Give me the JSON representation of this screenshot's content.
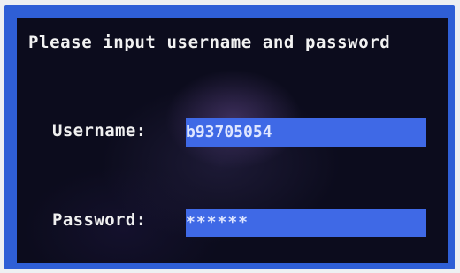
{
  "login_screen": {
    "prompt": "Please input username and password",
    "username_label": "Username:",
    "username_value": "b93705054",
    "password_label": "Password:",
    "password_value": "******"
  },
  "colors": {
    "monitor_bezel": "#2f5fd6",
    "screen_background": "#0c0c1d",
    "field_background": "#3f69e6",
    "text": "#f2f2f2"
  }
}
